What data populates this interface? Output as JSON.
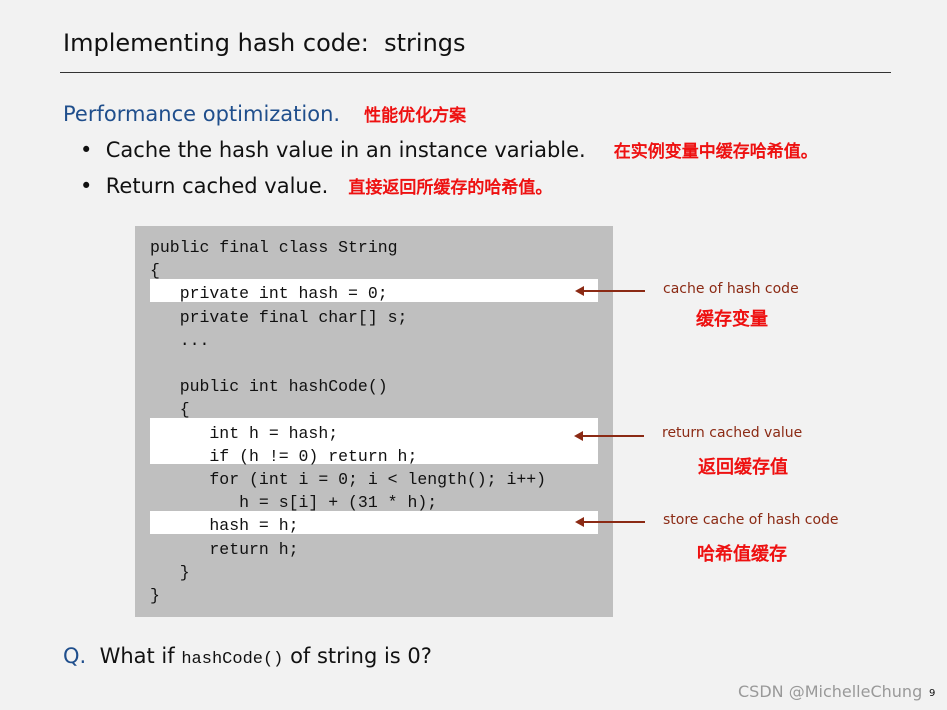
{
  "title": "Implementing hash code:  strings",
  "performance": {
    "heading": "Performance optimization.",
    "heading_cn": "性能优化方案"
  },
  "bullets": [
    {
      "text": "Cache the hash value in an instance variable.",
      "cn": "在实例变量中缓存哈希值。"
    },
    {
      "text": "Return cached value.",
      "cn": "直接返回所缓存的哈希值。"
    }
  ],
  "code_lines": [
    "public final class String",
    "{",
    "   private int hash = 0;",
    "   private final char[] s;",
    "   ...",
    "",
    "   public int hashCode()",
    "   {",
    "      int h = hash;",
    "      if (h != 0) return h;",
    "      for (int i = 0; i < length(); i++)",
    "         h = s[i] + (31 * h);",
    "      hash = h;",
    "      return h;",
    "   }",
    "}"
  ],
  "annotations": [
    {
      "text": "cache of hash code",
      "cn": "缓存变量"
    },
    {
      "text": "return cached value",
      "cn": "返回缓存值"
    },
    {
      "text": "store cache of hash code",
      "cn": "哈希值缓存"
    }
  ],
  "question": {
    "label": "Q.",
    "pre": "What if",
    "code": "hashCode()",
    "post": "of string is 0?"
  },
  "watermark": "CSDN @MichelleChung",
  "page_number": "9",
  "colors": {
    "accent_blue": "#1f4e8c",
    "annotation": "#8b2a14",
    "chinese_note": "#ee1111",
    "code_bg": "#bfbfbf"
  }
}
